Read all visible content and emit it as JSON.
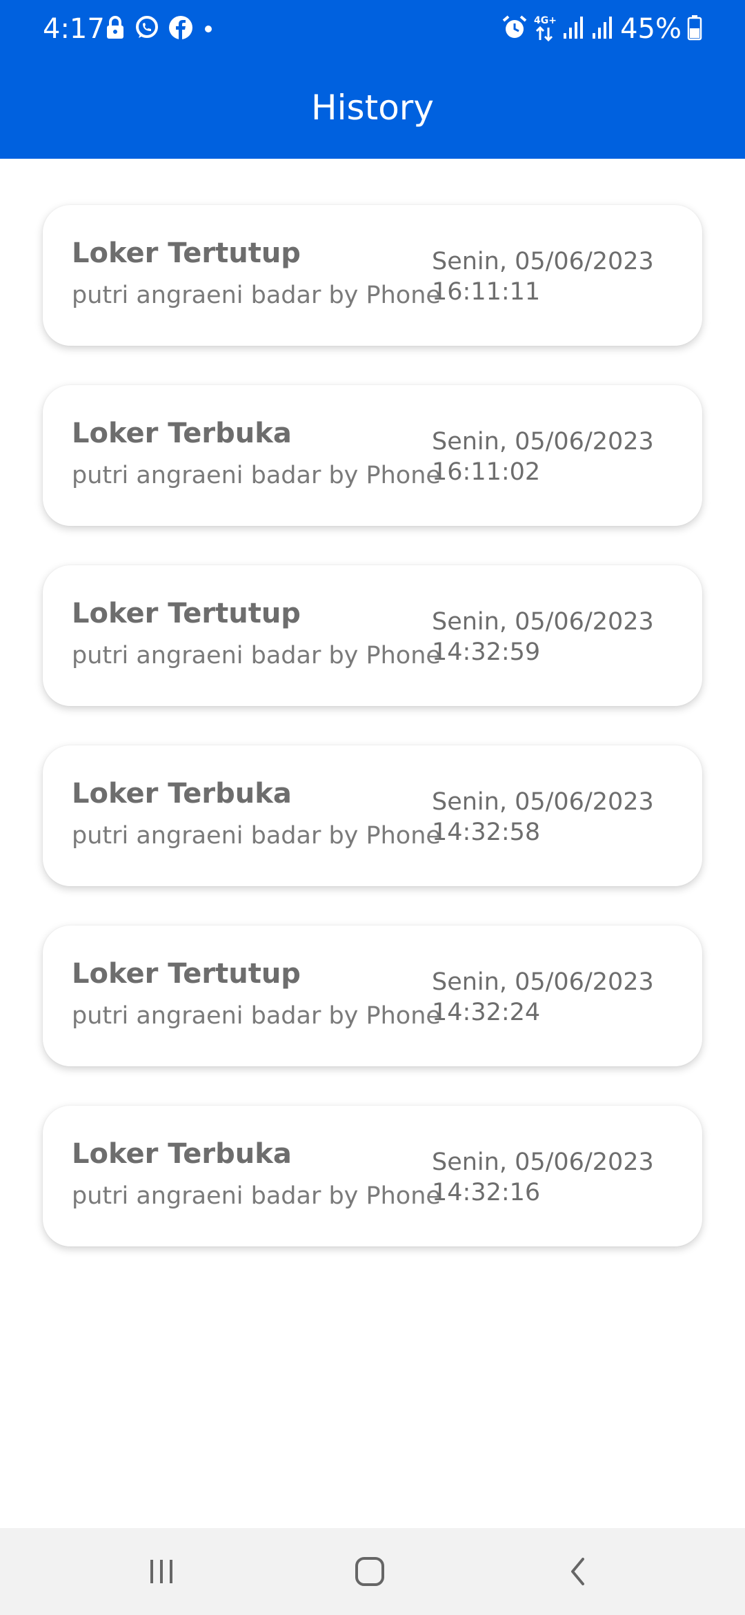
{
  "status_bar": {
    "time": "4:17",
    "battery_percent": "45%",
    "left_icons": [
      "lock-icon",
      "whatsapp-icon",
      "facebook-icon",
      "dot-icon"
    ],
    "right_icons": [
      "alarm-icon",
      "network-4g-icon",
      "signal-icon",
      "signal-icon",
      "battery-icon"
    ]
  },
  "header": {
    "title": "History",
    "color": "#0061df"
  },
  "history": [
    {
      "title": "Loker Tertutup",
      "subtitle": "putri angraeni badar by Phone",
      "date": "Senin, 05/06/2023",
      "time": "16:11:11"
    },
    {
      "title": "Loker Terbuka",
      "subtitle": "putri angraeni badar by Phone",
      "date": "Senin, 05/06/2023",
      "time": "16:11:02"
    },
    {
      "title": "Loker Tertutup",
      "subtitle": "putri angraeni badar by Phone",
      "date": "Senin, 05/06/2023",
      "time": "14:32:59"
    },
    {
      "title": "Loker Terbuka",
      "subtitle": "putri angraeni badar by Phone",
      "date": "Senin, 05/06/2023",
      "time": "14:32:58"
    },
    {
      "title": "Loker Tertutup",
      "subtitle": "putri angraeni badar by Phone",
      "date": "Senin, 05/06/2023",
      "time": "14:32:24"
    },
    {
      "title": "Loker Terbuka",
      "subtitle": "putri angraeni badar by Phone",
      "date": "Senin, 05/06/2023",
      "time": "14:32:16"
    }
  ],
  "nav_bar": {
    "icons": [
      "recent-apps-icon",
      "home-icon",
      "back-icon"
    ]
  }
}
